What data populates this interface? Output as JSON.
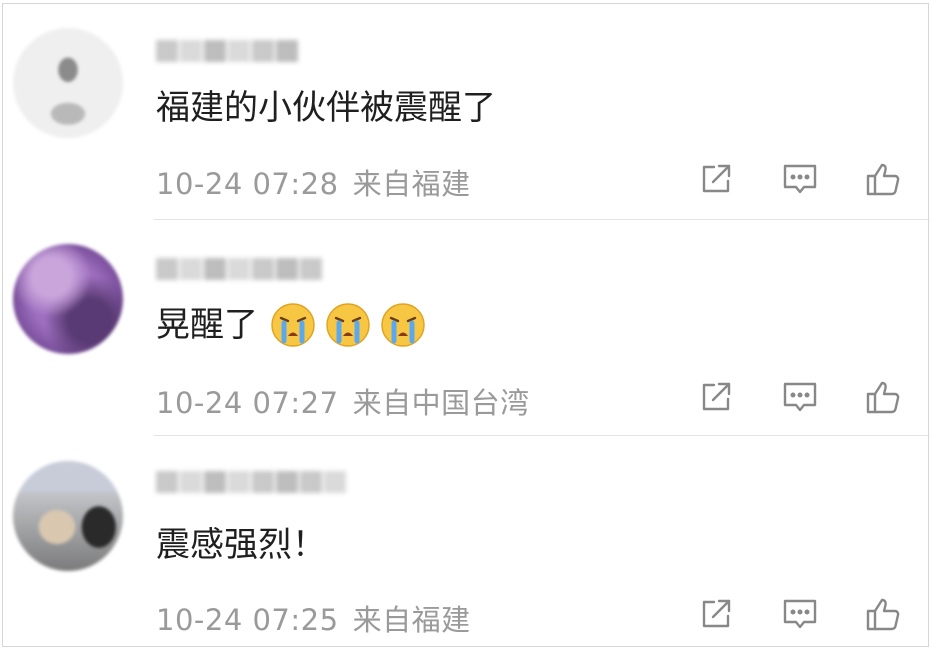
{
  "comments": [
    {
      "text": "福建的小伙伴被震醒了",
      "emojis": [],
      "time": "10-24 07:28",
      "location": "来自福建"
    },
    {
      "text": "晃醒了",
      "emojis": [
        "crying-face",
        "crying-face",
        "crying-face"
      ],
      "time": "10-24 07:27",
      "location": "来自中国台湾"
    },
    {
      "text": "震感强烈！",
      "emojis": [],
      "time": "10-24 07:25",
      "location": "来自福建"
    }
  ],
  "icons": {
    "share": "share-icon",
    "reply": "comment-icon",
    "like": "thumbs-up-icon"
  },
  "colors": {
    "text": "#1f1f1f",
    "meta": "#9a9a9a",
    "icon": "#888888",
    "divider": "#e4e4e4"
  }
}
